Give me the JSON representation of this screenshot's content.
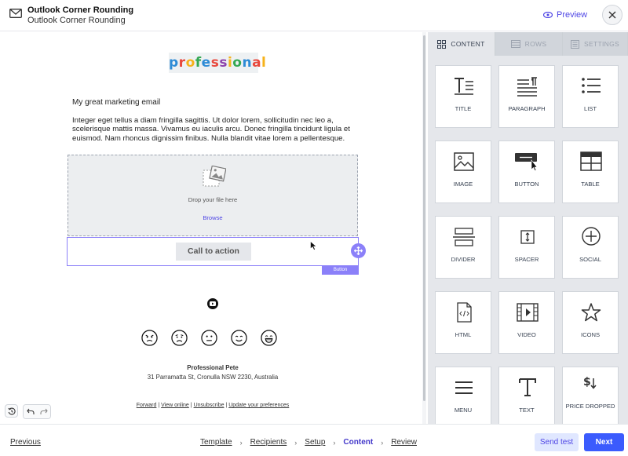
{
  "header": {
    "title": "Outlook Corner Rounding",
    "subtitle": "Outlook Corner Rounding",
    "preview_label": "Preview",
    "icons": {
      "mail": "envelope-icon",
      "preview": "eye-icon",
      "close": "close-icon"
    }
  },
  "email": {
    "logo_text": "professional",
    "heading": "My great marketing email",
    "body": "Integer eget tellus a diam fringilla sagittis. Ut dolor lorem, sollicitudin nec leo a, scelerisque mattis massa. Vivamus eu iaculis arcu. Donec fringilla tincidunt ligula et euismod. Nam rhoncus dignissim finibus. Nulla blandit vitae lorem a pellentesque.",
    "image_block": {
      "drop_text": "Drop your file here",
      "browse_label": "Browse"
    },
    "button_block": {
      "cta_label": "Call to action",
      "tag_label": "Button"
    },
    "social_icon": "youtube-icon",
    "emojis": [
      "angry-face-icon",
      "sad-face-icon",
      "neutral-face-icon",
      "smiling-face-icon",
      "grinning-face-icon"
    ],
    "signature": {
      "name": "Professional Pete",
      "address": "31 Parramatta St, Cronulla NSW 2230, Australia"
    },
    "footer_links": [
      "Forward",
      "View online",
      "Unsubscribe",
      "Update your preferences"
    ],
    "footer_separator": "|"
  },
  "panel": {
    "tabs": [
      {
        "label": "CONTENT",
        "icon": "grid-icon",
        "active": true
      },
      {
        "label": "ROWS",
        "icon": "rows-icon",
        "active": false
      },
      {
        "label": "SETTINGS",
        "icon": "settings-icon",
        "active": false
      }
    ],
    "tiles": [
      {
        "label": "TITLE",
        "icon": "title-icon"
      },
      {
        "label": "PARAGRAPH",
        "icon": "paragraph-icon"
      },
      {
        "label": "LIST",
        "icon": "list-icon"
      },
      {
        "label": "IMAGE",
        "icon": "image-icon"
      },
      {
        "label": "BUTTON",
        "icon": "button-icon"
      },
      {
        "label": "TABLE",
        "icon": "table-icon"
      },
      {
        "label": "DIVIDER",
        "icon": "divider-icon"
      },
      {
        "label": "SPACER",
        "icon": "spacer-icon"
      },
      {
        "label": "SOCIAL",
        "icon": "social-icon"
      },
      {
        "label": "HTML",
        "icon": "html-icon"
      },
      {
        "label": "VIDEO",
        "icon": "video-icon"
      },
      {
        "label": "ICONS",
        "icon": "star-icon"
      },
      {
        "label": "MENU",
        "icon": "menu-icon"
      },
      {
        "label": "TEXT",
        "icon": "text-icon"
      },
      {
        "label": "PRICE DROPPED",
        "icon": "price-dropped-icon"
      }
    ]
  },
  "footer": {
    "previous_label": "Previous",
    "steps": [
      "Template",
      "Recipients",
      "Setup",
      "Content",
      "Review"
    ],
    "current_step": "Content",
    "send_test_label": "Send test",
    "next_label": "Next"
  },
  "colors": {
    "accent": "#8b80f9",
    "primary": "#3b5bfd",
    "link": "#4f46e5",
    "panel_bg": "#e5e7eb"
  }
}
